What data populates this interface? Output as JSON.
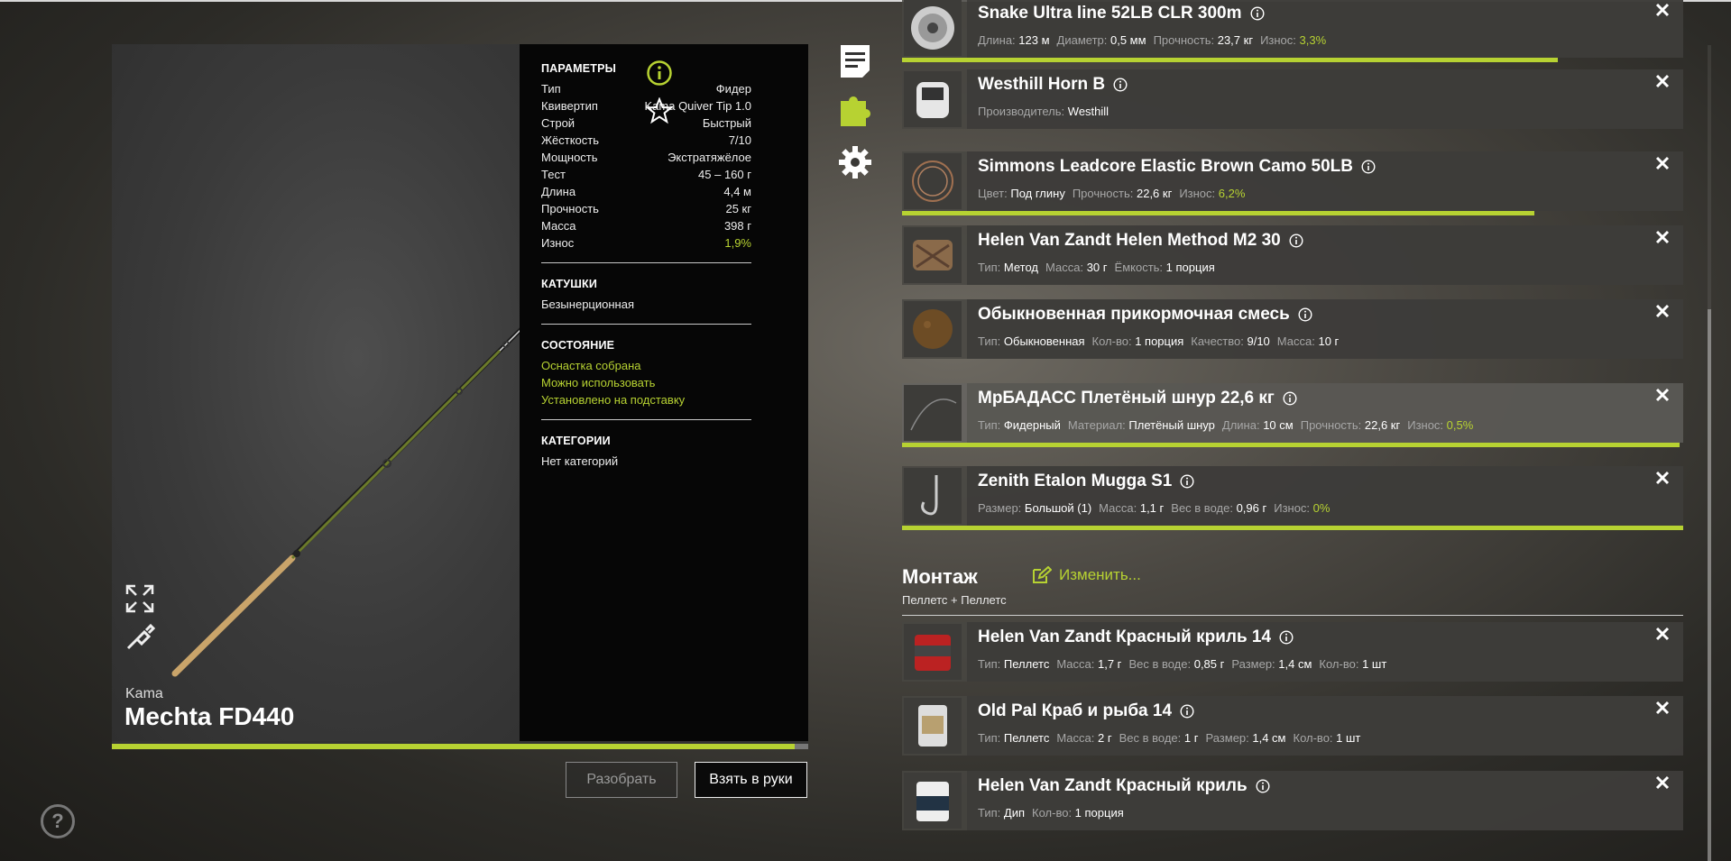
{
  "rod": {
    "brand": "Kama",
    "model": "Mechta FD440",
    "progress": 0.98
  },
  "params": {
    "title": "ПАРАМЕТРЫ",
    "rows": [
      {
        "k": "Тип",
        "v": "Фидер"
      },
      {
        "k": "Квивертип",
        "v": "Kama Quiver Tip 1.0"
      },
      {
        "k": "Строй",
        "v": "Быстрый"
      },
      {
        "k": "Жёсткость",
        "v": "7/10"
      },
      {
        "k": "Мощность",
        "v": "Экстратяжёлое"
      },
      {
        "k": "Тест",
        "v": "45 – 160 г"
      },
      {
        "k": "Длина",
        "v": "4,4 м"
      },
      {
        "k": "Прочность",
        "v": "25 кг"
      },
      {
        "k": "Масса",
        "v": "398 г"
      },
      {
        "k": "Износ",
        "v": "1,9%"
      }
    ],
    "reels_title": "КАТУШКИ",
    "reels_value": "Безынерционная",
    "state_title": "СОСТОЯНИЕ",
    "state_items": [
      "Оснастка собрана",
      "Можно использовать",
      "Установлено на подставку"
    ],
    "categories_title": "КАТЕГОРИИ",
    "categories_value": "Нет категорий"
  },
  "buttons": {
    "disassemble": "Разобрать",
    "take": "Взять в руки"
  },
  "items": [
    {
      "name": "Snake Ultra line 52LB CLR 300m",
      "props": [
        [
          "Длина:",
          "123 м"
        ],
        [
          "Диаметр:",
          "0,5 мм"
        ],
        [
          "Прочность:",
          "23,7 кг"
        ],
        [
          "Износ:",
          "3,3%"
        ]
      ],
      "wear": 0.84
    },
    {
      "name": "Westhill Horn B",
      "props": [
        [
          "Производитель:",
          "Westhill"
        ]
      ]
    },
    {
      "name": "Simmons Leadcore Elastic Brown Camo 50LB",
      "props": [
        [
          "Цвет:",
          "Под глину"
        ],
        [
          "Прочность:",
          "22,6 кг"
        ],
        [
          "Износ:",
          "6,2%"
        ]
      ],
      "wear": 0.81
    },
    {
      "name": "Helen Van Zandt Helen Method M2 30",
      "props": [
        [
          "Тип:",
          "Метод"
        ],
        [
          "Масса:",
          "30 г"
        ],
        [
          "Ёмкость:",
          "1 порция"
        ]
      ]
    },
    {
      "name": "Обыкновенная прикормочная смесь",
      "props": [
        [
          "Тип:",
          "Обыкновенная"
        ],
        [
          "Кол-во:",
          "1 порция"
        ],
        [
          "Качество:",
          "9/10"
        ],
        [
          "Масса:",
          "10 г"
        ]
      ]
    },
    {
      "name": "МрБАДАСС Плетёный шнур 22,6 кг",
      "props": [
        [
          "Тип:",
          "Фидерный"
        ],
        [
          "Материал:",
          "Плетёный шнур"
        ],
        [
          "Длина:",
          "10 см"
        ],
        [
          "Прочность:",
          "22,6 кг"
        ],
        [
          "Износ:",
          "0,5%"
        ]
      ],
      "wear": 0.995
    },
    {
      "name": "Zenith Etalon Mugga S1",
      "props": [
        [
          "Размер:",
          "Большой (1)"
        ],
        [
          "Масса:",
          "1,1 г"
        ],
        [
          "Вес в воде:",
          "0,96 г"
        ],
        [
          "Износ:",
          "0%"
        ]
      ],
      "wear": 1.0
    }
  ],
  "mount": {
    "title": "Монтаж",
    "edit": "Изменить...",
    "sub": "Пеллетс + Пеллетс"
  },
  "baits": [
    {
      "name": "Helen Van Zandt Красный криль 14",
      "props": [
        [
          "Тип:",
          "Пеллетс"
        ],
        [
          "Масса:",
          "1,7 г"
        ],
        [
          "Вес в воде:",
          "0,85 г"
        ],
        [
          "Размер:",
          "1,4 см"
        ],
        [
          "Кол-во:",
          "1 шт"
        ]
      ]
    },
    {
      "name": "Old Pal Краб и рыба 14",
      "props": [
        [
          "Тип:",
          "Пеллетс"
        ],
        [
          "Масса:",
          "2 г"
        ],
        [
          "Вес в воде:",
          "1 г"
        ],
        [
          "Размер:",
          "1,4 см"
        ],
        [
          "Кол-во:",
          "1 шт"
        ]
      ]
    },
    {
      "name": "Helen Van Zandt Красный криль",
      "props": [
        [
          "Тип:",
          "Дип"
        ],
        [
          "Кол-во:",
          "1 порция"
        ]
      ]
    }
  ],
  "colors": {
    "accent": "#b7d232",
    "panel_dark": "#060606"
  },
  "help": "?"
}
